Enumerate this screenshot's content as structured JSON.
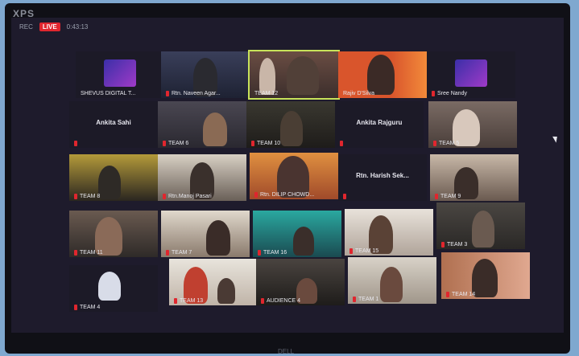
{
  "monitor": {
    "brand": "XPS",
    "stand_text": "DELL"
  },
  "meeting": {
    "rec_label": "REC",
    "live_badge": "LIVE",
    "status_text": "0:43:13"
  },
  "participants": [
    {
      "name": "SHEVUS DIGITAL T...",
      "muted": false
    },
    {
      "name": "Rtn. Naveen Agar...",
      "muted": true
    },
    {
      "name": "TEAM 12",
      "muted": false,
      "active_speaker": true
    },
    {
      "name": "Rajiv D'Silva",
      "muted": false
    },
    {
      "name": "Sree Nandy",
      "muted": true
    },
    {
      "name": "Ankita Sahi",
      "muted": true,
      "video_off": true
    },
    {
      "name": "TEAM 6",
      "muted": true
    },
    {
      "name": "TEAM 10",
      "muted": true
    },
    {
      "name": "Ankita Rajguru",
      "muted": true,
      "video_off": true
    },
    {
      "name": "TEAM 5",
      "muted": true
    },
    {
      "name": "TEAM 8",
      "muted": true
    },
    {
      "name": "Rtn.Manoj Pasari",
      "muted": true
    },
    {
      "name": "Rtn. DILIP CHOWD...",
      "muted": true
    },
    {
      "name": "Rtn. Harish Sek...",
      "muted": true,
      "video_off": true
    },
    {
      "name": "TEAM 9",
      "muted": true
    },
    {
      "name": "TEAM 11",
      "muted": true
    },
    {
      "name": "TEAM 7",
      "muted": true
    },
    {
      "name": "TEAM 16",
      "muted": true
    },
    {
      "name": "TEAM 15",
      "muted": true
    },
    {
      "name": "TEAM 3",
      "muted": true
    },
    {
      "name": "TEAM 4",
      "muted": true
    },
    {
      "name": "TEAM 13",
      "muted": true
    },
    {
      "name": "AUDIENCE 4",
      "muted": true
    },
    {
      "name": "TEAM 1",
      "muted": true
    },
    {
      "name": "TEAM 14",
      "muted": true
    }
  ]
}
